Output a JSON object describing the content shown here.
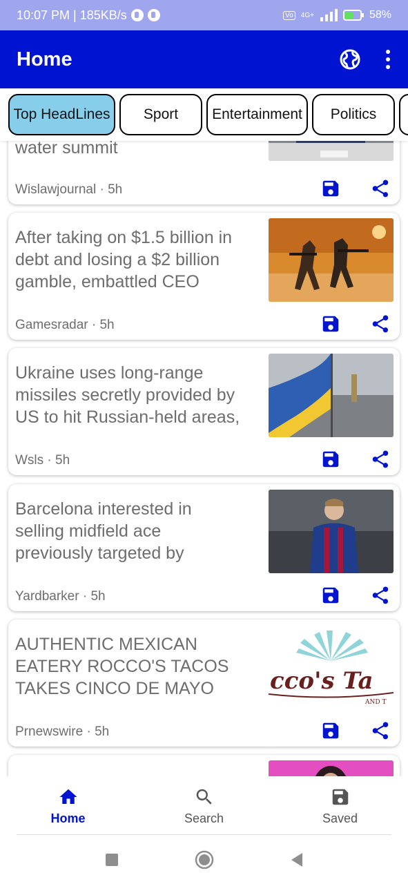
{
  "status_bar": {
    "time_speed": "10:07 PM | 185KB/s",
    "network": "4G+",
    "battery": "58%"
  },
  "app_bar": {
    "title": "Home",
    "globe_icon": "globe-icon",
    "more_icon": "more-vert-icon",
    "color": "#0013d0"
  },
  "tabs": [
    {
      "label": "Top HeadLines",
      "active": true
    },
    {
      "label": "Sport",
      "active": false
    },
    {
      "label": "Entertainment",
      "active": false
    },
    {
      "label": "Politics",
      "active": false
    }
  ],
  "articles": [
    {
      "title": "water summit",
      "source": "Wislawjournal · 5h",
      "image": "news-conference-photo"
    },
    {
      "title": "After taking on $1.5 billion in debt and losing a $2 billion gamble, embattled CEO",
      "source": "Gamesradar · 5h",
      "image": "video-game-soldiers-photo"
    },
    {
      "title": "Ukraine uses long-range missiles secretly provided by US to hit Russian-held areas,",
      "source": "Wsls · 5h",
      "image": "ukraine-flag-city-photo"
    },
    {
      "title": "Barcelona interested in selling midfield ace previously targeted by",
      "source": "Yardbarker · 5h",
      "image": "barcelona-player-photo"
    },
    {
      "title": "AUTHENTIC MEXICAN EATERY ROCCO'S TACOS TAKES CINCO DE MAYO",
      "source": "Prnewswire · 5h",
      "image": "roccos-tacos-logo",
      "logo_text": "cco's Ta",
      "logo_subtext": "AND T"
    },
    {
      "title": "",
      "source": "",
      "image": "woman-portrait-photo"
    }
  ],
  "bottom_nav": [
    {
      "label": "Home",
      "icon": "home-icon",
      "active": true
    },
    {
      "label": "Search",
      "icon": "search-icon",
      "active": false
    },
    {
      "label": "Saved",
      "icon": "save-icon",
      "active": false
    }
  ],
  "colors": {
    "accent": "#0013d0",
    "active_tab": "#87ceeb",
    "status_bar": "#9fa6ee"
  }
}
